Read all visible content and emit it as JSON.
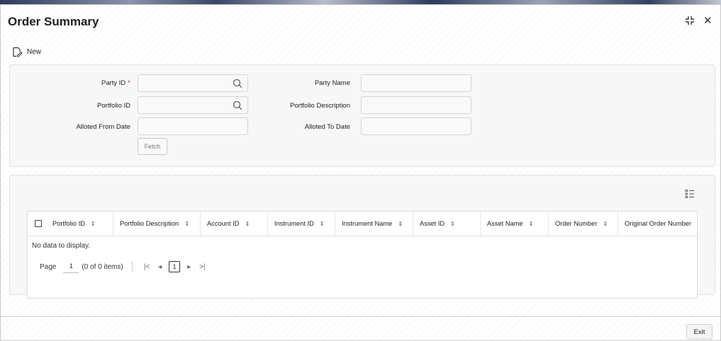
{
  "window": {
    "title": "Order Summary",
    "controls": {
      "expand_icon": "expand-icon",
      "close_glyph": "✕"
    }
  },
  "toolbar": {
    "new_label": "New",
    "new_icon": "new-record-icon"
  },
  "form": {
    "party_id_label": "Party ID",
    "party_id_required": "*",
    "party_name_label": "Party Name",
    "portfolio_id_label": "Portfolio ID",
    "portfolio_description_label": "Portfolio Description",
    "alloted_from_date_label": "Alloted From Date",
    "alloted_to_date_label": "Alloted To Date",
    "fetch_label": "Fetch"
  },
  "table": {
    "columns": [
      "Portfolio ID",
      "Portfolio Description",
      "Account ID",
      "Instrument ID",
      "Instrument Name",
      "Asset ID",
      "Asset Name",
      "Order Number",
      "Original Order Number"
    ],
    "empty_text": "No data to display.",
    "pager": {
      "page_label": "Page",
      "page_value": "1",
      "items_text": "(0 of 0 items)",
      "current_page": "1"
    }
  },
  "footer": {
    "exit_label": "Exit"
  },
  "colors": {
    "required": "#c2322b",
    "panel_bg": "#f7f7f7"
  }
}
